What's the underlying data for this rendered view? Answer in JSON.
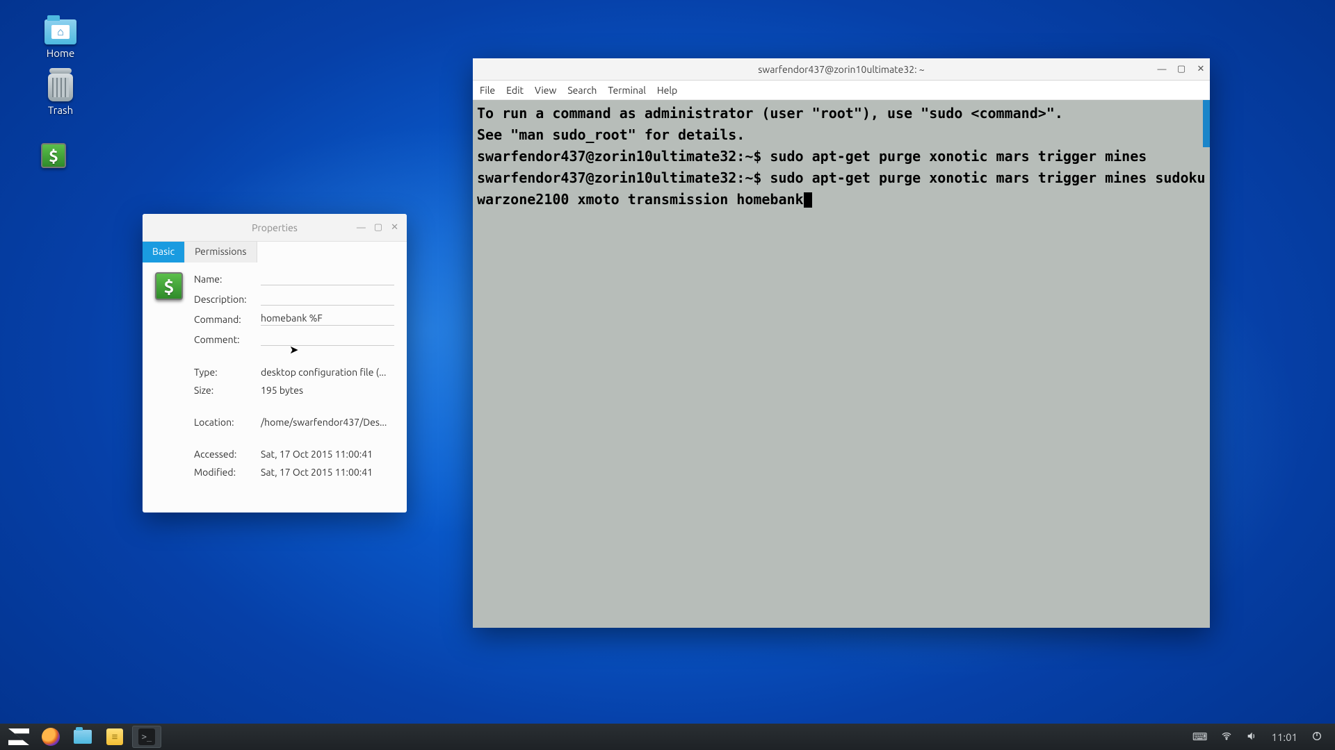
{
  "desktop": {
    "icons": {
      "home": "Home",
      "trash": "Trash",
      "homebank": "$"
    }
  },
  "properties": {
    "title": "Properties",
    "tabs": {
      "basic": "Basic",
      "permissions": "Permissions"
    },
    "labels": {
      "name": "Name:",
      "description": "Description:",
      "command": "Command:",
      "comment": "Comment:",
      "type": "Type:",
      "size": "Size:",
      "location": "Location:",
      "accessed": "Accessed:",
      "modified": "Modified:"
    },
    "values": {
      "name": "",
      "description": "",
      "command": "homebank %F",
      "comment": "",
      "type": "desktop configuration file (...",
      "size": "195 bytes",
      "location": "/home/swarfendor437/Des...",
      "accessed": "Sat, 17 Oct 2015 11:00:41",
      "modified": "Sat, 17 Oct 2015 11:00:41"
    },
    "icon_glyph": "$"
  },
  "terminal": {
    "title": "swarfendor437@zorin10ultimate32: ~",
    "menu": [
      "File",
      "Edit",
      "View",
      "Search",
      "Terminal",
      "Help"
    ],
    "lines": [
      "To run a command as administrator (user \"root\"), use \"sudo <command>\".",
      "See \"man sudo_root\" for details.",
      "swarfendor437@zorin10ultimate32:~$ sudo apt-get purge xonotic mars trigger mines",
      "swarfendor437@zorin10ultimate32:~$ sudo apt-get purge xonotic mars trigger mines sudoku warzone2100 xmoto transmission homebank"
    ]
  },
  "taskbar": {
    "clock": "11:01",
    "tray": {
      "keyboard": "⌨",
      "wifi": "wifi-icon",
      "volume": "volume-icon",
      "power": "power-icon"
    }
  }
}
